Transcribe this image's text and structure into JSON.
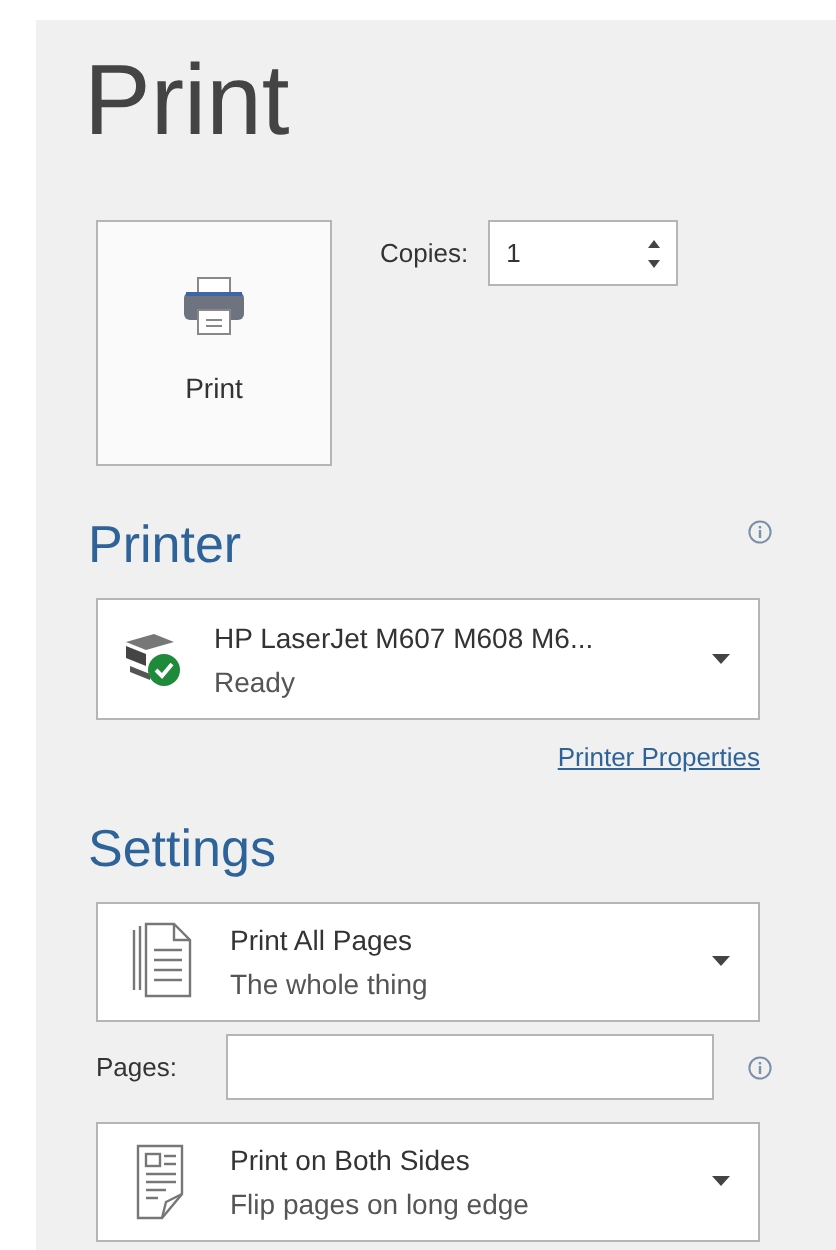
{
  "title": "Print",
  "print_button": {
    "label": "Print"
  },
  "copies": {
    "label": "Copies:",
    "value": "1"
  },
  "printer": {
    "heading": "Printer",
    "name": "HP LaserJet M607 M608 M6...",
    "status": "Ready",
    "link": "Printer Properties"
  },
  "settings": {
    "heading": "Settings",
    "dropdowns": [
      {
        "kind": "pages",
        "title": "Print All Pages",
        "subtitle": "The whole thing"
      },
      {
        "kind": "duplex",
        "title": "Print on Both Sides",
        "subtitle": "Flip pages on long edge"
      }
    ],
    "pages": {
      "label": "Pages:"
    }
  }
}
